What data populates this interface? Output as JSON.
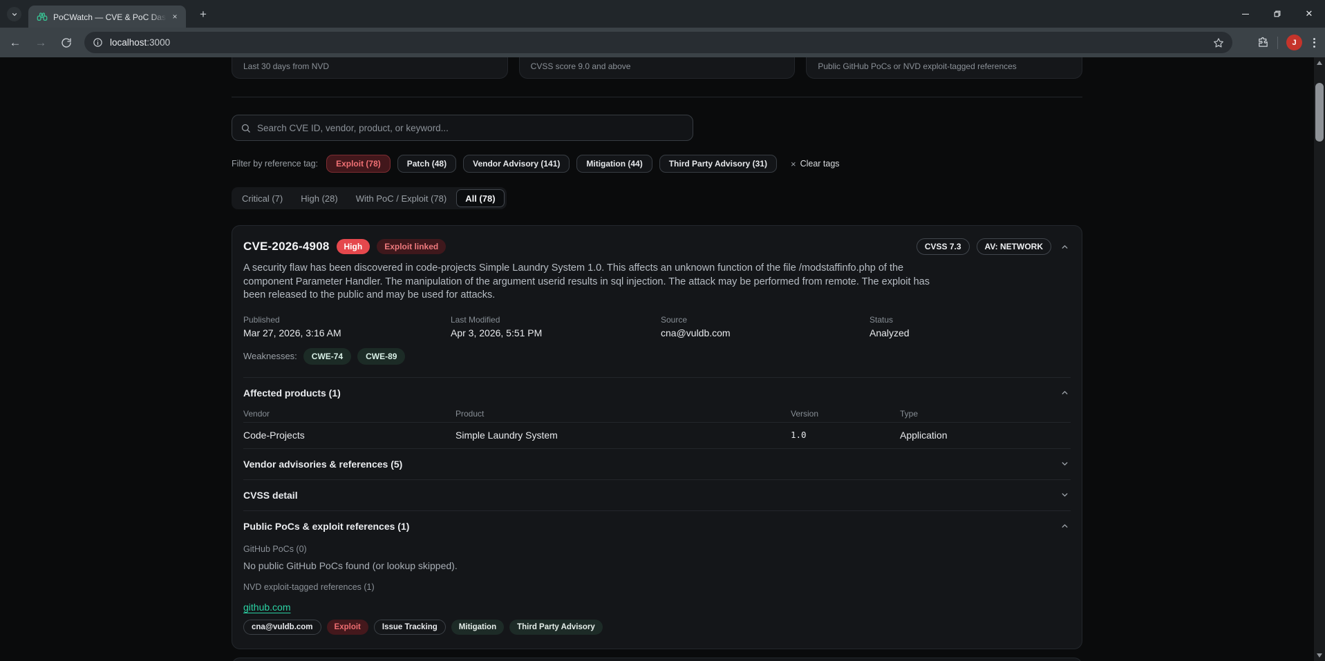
{
  "colors": {
    "accent_red": "#e5484d",
    "accent_teal": "#2bd3a4",
    "page_bg": "#0a0b0c",
    "card_bg": "#141619"
  },
  "browser": {
    "tab_title": "PoCWatch — CVE & PoC Dashb",
    "url_host": "localhost",
    "url_port": ":3000",
    "profile_initial": "J"
  },
  "stat_cards": [
    {
      "caption": "Last 30 days from NVD"
    },
    {
      "caption": "CVSS score 9.0 and above"
    },
    {
      "caption": "Public GitHub PoCs or NVD exploit-tagged references"
    }
  ],
  "search": {
    "placeholder": "Search CVE ID, vendor, product, or keyword..."
  },
  "filters": {
    "label": "Filter by reference tag:",
    "pills": [
      {
        "label": "Exploit (78)",
        "active": true
      },
      {
        "label": "Patch (48)",
        "active": false
      },
      {
        "label": "Vendor Advisory (141)",
        "active": false
      },
      {
        "label": "Mitigation (44)",
        "active": false
      },
      {
        "label": "Third Party Advisory (31)",
        "active": false
      }
    ],
    "clear_icon": "×",
    "clear_label": "Clear tags"
  },
  "severity_tabs": [
    {
      "label": "Critical (7)",
      "active": false
    },
    {
      "label": "High (28)",
      "active": false
    },
    {
      "label": "With PoC / Exploit (78)",
      "active": false
    },
    {
      "label": "All (78)",
      "active": true
    }
  ],
  "cve": {
    "id": "CVE-2026-4908",
    "severity_badge": "High",
    "exploit_badge": "Exploit linked",
    "cvss_badge": "CVSS 7.3",
    "av_badge": "AV: NETWORK",
    "description": "A security flaw has been discovered in code-projects Simple Laundry System 1.0. This affects an unknown function of the file /modstaffinfo.php of the component Parameter Handler. The manipulation of the argument userid results in sql injection. The attack may be performed from remote. The exploit has been released to the public and may be used for attacks.",
    "meta": {
      "published_label": "Published",
      "published": "Mar 27, 2026, 3:16 AM",
      "modified_label": "Last Modified",
      "modified": "Apr 3, 2026, 5:51 PM",
      "source_label": "Source",
      "source": "cna@vuldb.com",
      "status_label": "Status",
      "status": "Analyzed"
    },
    "weaknesses_label": "Weaknesses:",
    "weaknesses": [
      "CWE-74",
      "CWE-89"
    ],
    "sections": {
      "affected": {
        "title": "Affected products (1)",
        "columns": [
          "Vendor",
          "Product",
          "Version",
          "Type"
        ],
        "rows": [
          [
            "Code-Projects",
            "Simple Laundry System",
            "1.0",
            "Application"
          ]
        ]
      },
      "advisories": {
        "title": "Vendor advisories & references (5)"
      },
      "cvss_detail": {
        "title": "CVSS detail"
      },
      "pocs": {
        "title": "Public PoCs & exploit references (1)",
        "github_label": "GitHub PoCs (0)",
        "github_empty": "No public GitHub PoCs found (or lookup skipped).",
        "nvd_label": "NVD exploit-tagged references (1)",
        "link": "github.com",
        "tags": [
          {
            "label": "cna@vuldb.com",
            "style": "outline"
          },
          {
            "label": "Exploit",
            "style": "red"
          },
          {
            "label": "Issue Tracking",
            "style": "outline"
          },
          {
            "label": "Mitigation",
            "style": "teal"
          },
          {
            "label": "Third Party Advisory",
            "style": "teal"
          }
        ]
      }
    }
  }
}
